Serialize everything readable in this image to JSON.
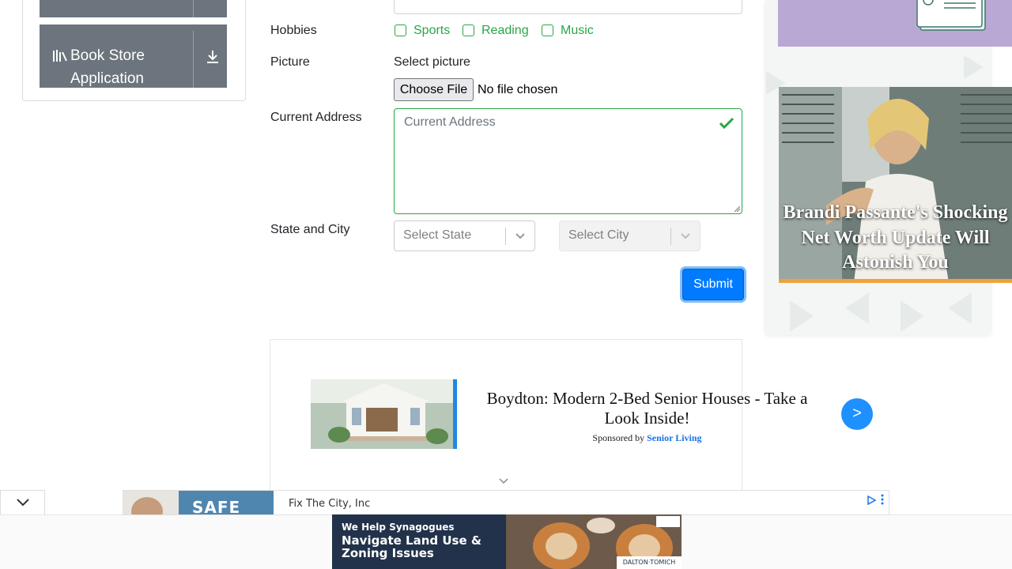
{
  "sidebar": {
    "book_store_label": "Book Store Application"
  },
  "form": {
    "hobbies_label": "Hobbies",
    "hobbies": [
      "Sports",
      "Reading",
      "Music"
    ],
    "picture_label": "Picture",
    "picture_hint": "Select picture",
    "file_button": "Choose File",
    "file_status": "No file chosen",
    "address_label": "Current Address",
    "address_placeholder": "Current Address",
    "state_city_label": "State and City",
    "state_placeholder": "Select State",
    "city_placeholder": "Select City",
    "submit_label": "Submit"
  },
  "ads": {
    "headline": "Brandi Passante's Shocking Net Worth Update Will Astonish You",
    "native_title": "Boydton: Modern 2-Bed Senior Houses - Take a Look Inside!",
    "native_sponsor_prefix": "Sponsored by",
    "native_sponsor_brand": "Senior Living",
    "native_go": ">",
    "strip_word": "SAFE",
    "strip_advertiser": "Fix The City, Inc",
    "banner_kicker": "We Help Synagogues",
    "banner_headline": "Navigate Land Use & Zoning Issues",
    "banner_brand": "DALTON·TOMICH"
  },
  "colors": {
    "valid_green": "#28a745",
    "primary_blue": "#007bff",
    "tile_gray": "#6c757d",
    "promo_lavender": "#b9a7d4"
  }
}
